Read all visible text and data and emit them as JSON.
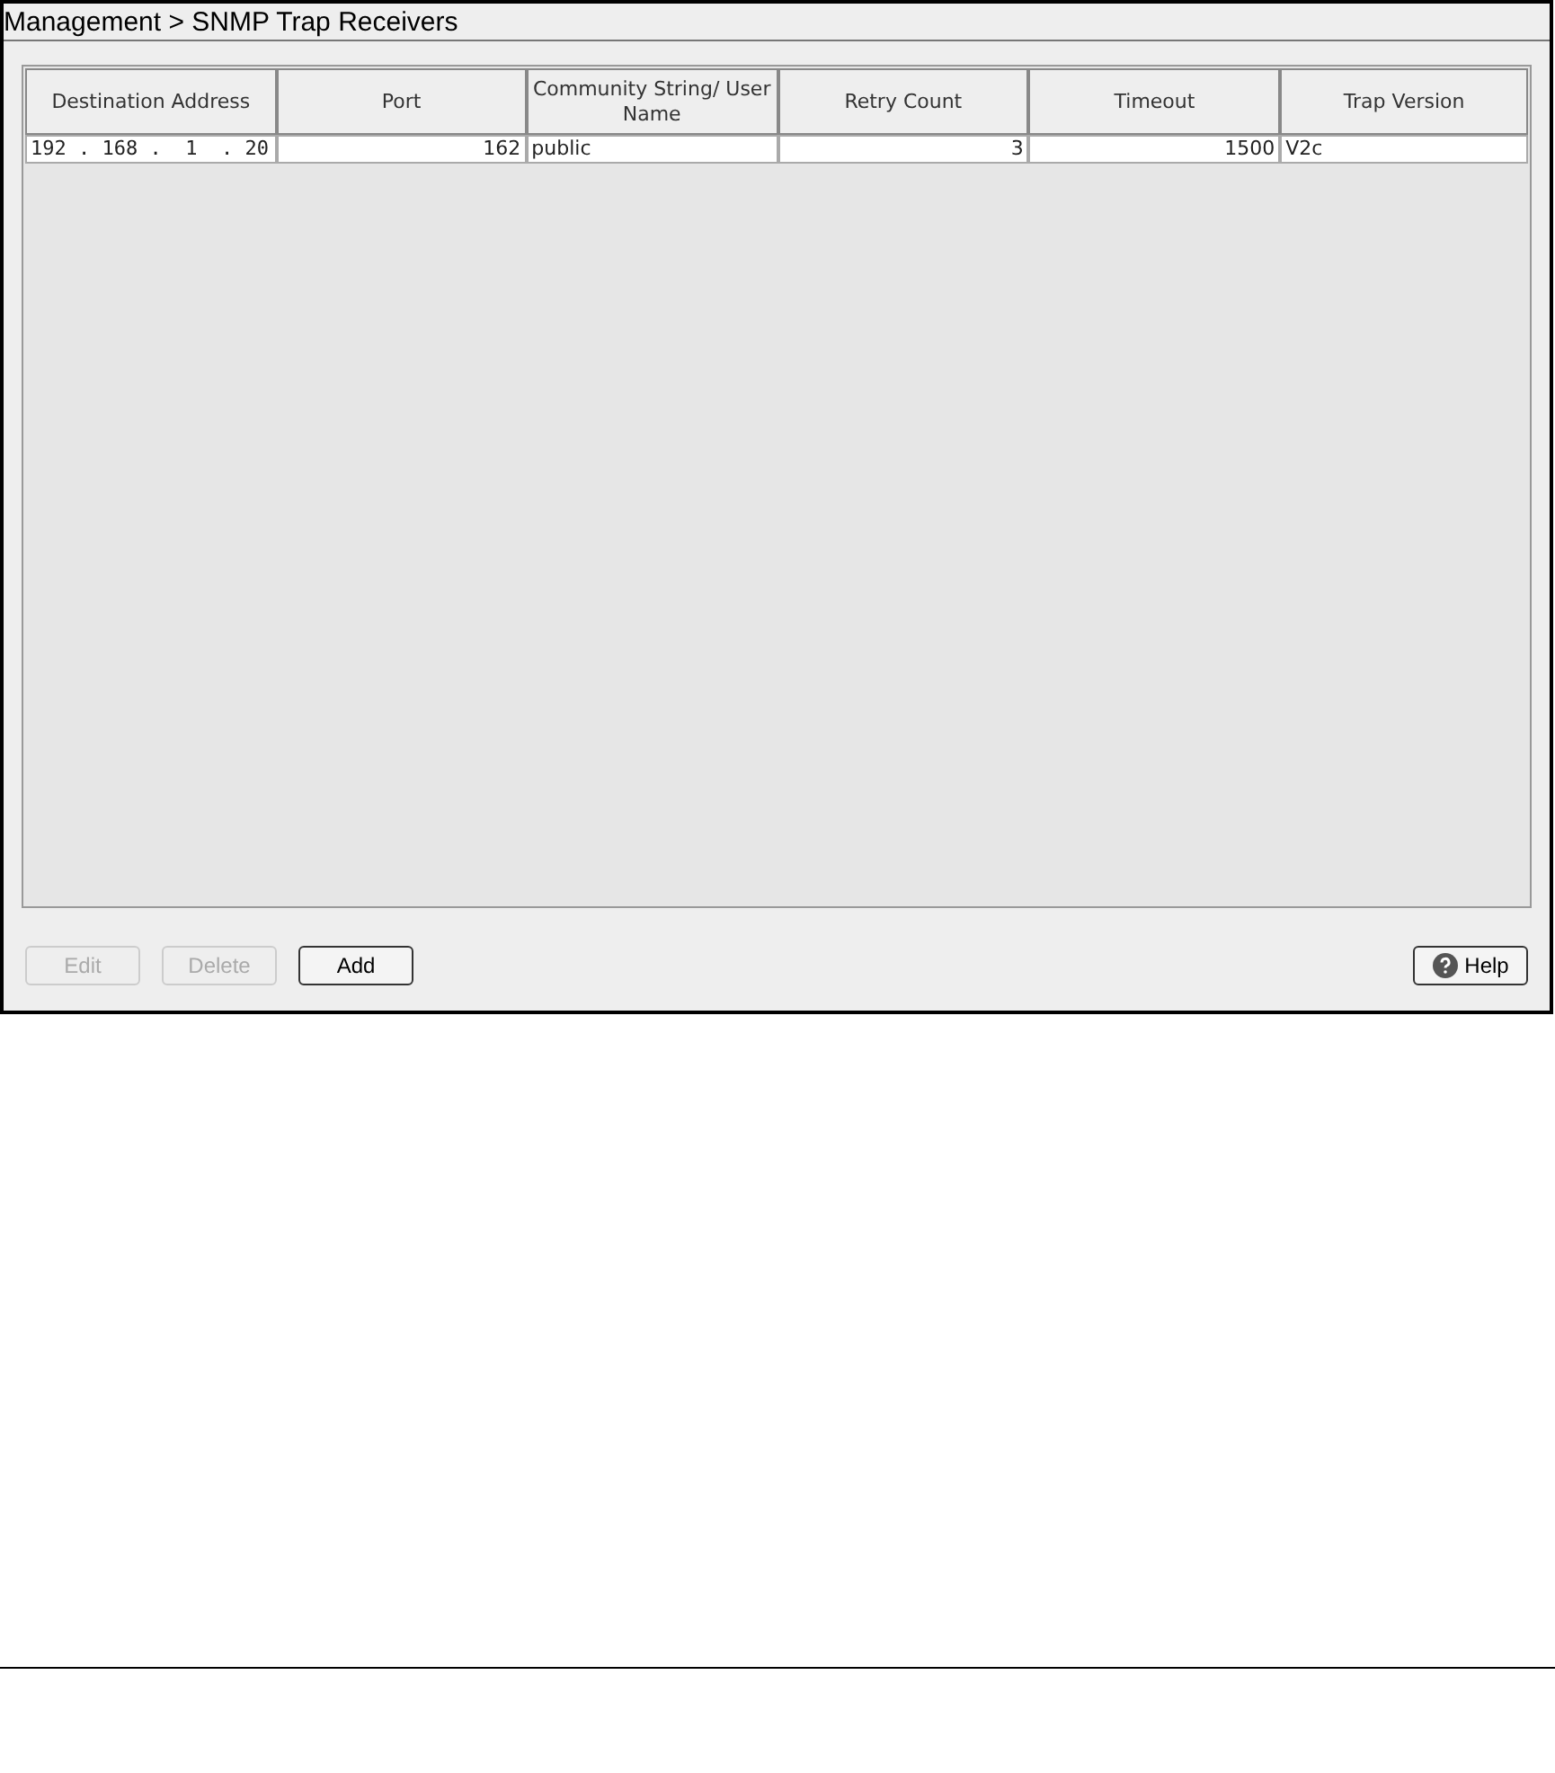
{
  "title": "Management > SNMP Trap Receivers",
  "table": {
    "columns": [
      "Destination Address",
      "Port",
      "Community String/ User Name",
      "Retry Count",
      "Timeout",
      "Trap Version"
    ],
    "rows": [
      {
        "selected": false,
        "cells": [
          "192 . 168 .  1  . 20",
          "162",
          "public",
          "3",
          "1500",
          "V2c"
        ]
      }
    ]
  },
  "buttons": [
    {
      "label": "Edit",
      "disabled": true
    },
    {
      "label": "Delete",
      "disabled": true
    },
    {
      "label": "Add",
      "disabled": false
    }
  ],
  "help": {
    "label": "Help"
  }
}
